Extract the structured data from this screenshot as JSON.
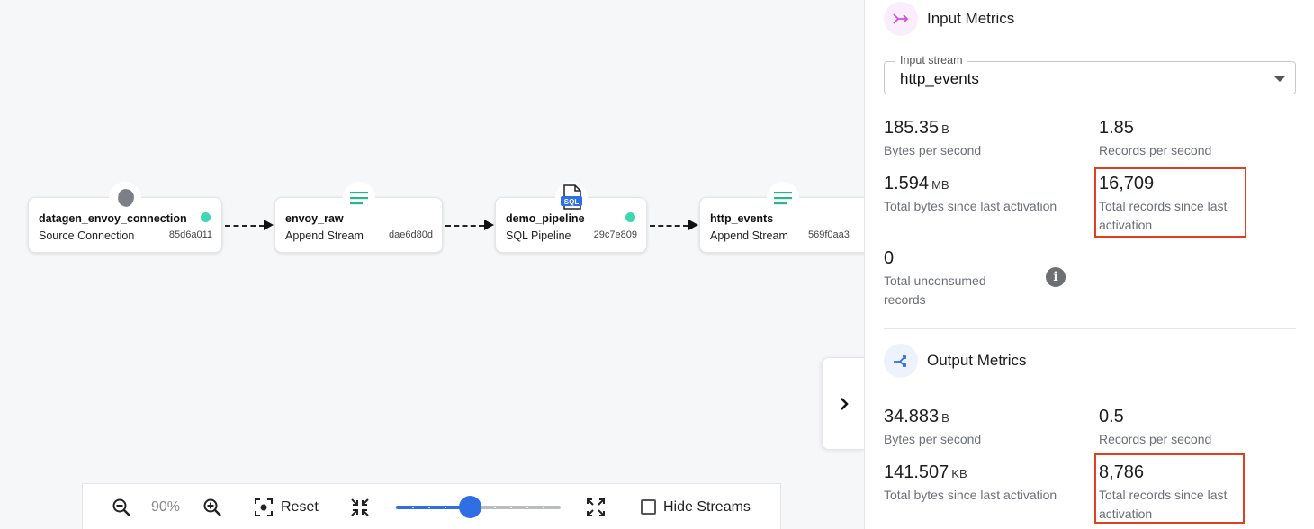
{
  "flow": {
    "nodes": [
      {
        "title": "datagen_envoy_connection",
        "subtitle": "Source Connection",
        "id": "85d6a011",
        "icon": "source-icon",
        "status": "active"
      },
      {
        "title": "envoy_raw",
        "subtitle": "Append Stream",
        "id": "dae6d80d",
        "icon": "stream-icon"
      },
      {
        "title": "demo_pipeline",
        "subtitle": "SQL Pipeline",
        "id": "29c7e809",
        "icon": "sql-file-icon",
        "badge": "SQL",
        "status": "active"
      },
      {
        "title": "http_events",
        "subtitle": "Append Stream",
        "id": "569f0aa3",
        "icon": "stream-icon"
      }
    ]
  },
  "toolbar": {
    "zoom_value": "90%",
    "reset_label": "Reset",
    "hide_streams_label": "Hide Streams",
    "slider_level": 0.45
  },
  "panel": {
    "input": {
      "title": "Input Metrics",
      "stream_label": "Input stream",
      "stream_value": "http_events",
      "bytes_per_second": {
        "value": "185.35",
        "unit": "B",
        "label": "Bytes per second"
      },
      "records_per_second": {
        "value": "1.85",
        "label": "Records per second"
      },
      "total_bytes": {
        "value": "1.594",
        "unit": "MB",
        "label": "Total bytes since last activation"
      },
      "total_records": {
        "value": "16,709",
        "label": "Total records since last activation"
      },
      "unconsumed": {
        "value": "0",
        "label": "Total unconsumed records"
      }
    },
    "output": {
      "title": "Output Metrics",
      "bytes_per_second": {
        "value": "34.883",
        "unit": "B",
        "label": "Bytes per second"
      },
      "records_per_second": {
        "value": "0.5",
        "label": "Records per second"
      },
      "total_bytes": {
        "value": "141.507",
        "unit": "KB",
        "label": "Total bytes since last activation"
      },
      "total_records": {
        "value": "8,786",
        "label": "Total records since last activation"
      }
    }
  },
  "colors": {
    "accent": "#2f6ee5",
    "status_active": "#3fd6b3",
    "stream_icon": "#2bb68d",
    "highlight": "#e0401f",
    "input_icon": "#d34fd6"
  }
}
